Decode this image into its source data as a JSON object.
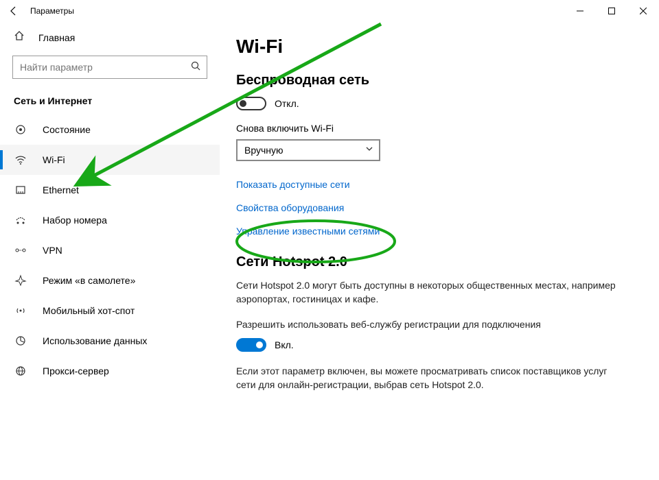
{
  "window": {
    "title": "Параметры"
  },
  "sidebar": {
    "home": "Главная",
    "search_placeholder": "Найти параметр",
    "section": "Сеть и Интернет",
    "items": [
      {
        "label": "Состояние"
      },
      {
        "label": "Wi-Fi",
        "active": true
      },
      {
        "label": "Ethernet"
      },
      {
        "label": "Набор номера"
      },
      {
        "label": "VPN"
      },
      {
        "label": "Режим «в самолете»"
      },
      {
        "label": "Мобильный хот-спот"
      },
      {
        "label": "Использование данных"
      },
      {
        "label": "Прокси-сервер"
      }
    ]
  },
  "content": {
    "title": "Wi-Fi",
    "wireless": {
      "heading": "Беспроводная сеть",
      "toggle_state": "Откл.",
      "toggle_on": false,
      "reenable_label": "Снова включить Wi-Fi",
      "reenable_value": "Вручную"
    },
    "links": {
      "show_networks": "Показать доступные сети",
      "hw_properties": "Свойства оборудования",
      "manage_known": "Управление известными сетями"
    },
    "hotspot": {
      "heading": "Сети Hotspot 2.0",
      "desc": "Сети Hotspot 2.0 могут быть доступны в некоторых общественных местах, например аэропортах, гостиницах и кафе.",
      "allow_label": "Разрешить использовать веб-службу регистрации для подключения",
      "toggle_state": "Вкл.",
      "toggle_on": true,
      "note": "Если этот параметр включен, вы можете просматривать список поставщиков услуг сети для онлайн-регистрации, выбрав сеть Hotspot 2.0."
    }
  },
  "annotation": {
    "arrow_color": "#18a818",
    "ellipse_target": "manage_known"
  }
}
